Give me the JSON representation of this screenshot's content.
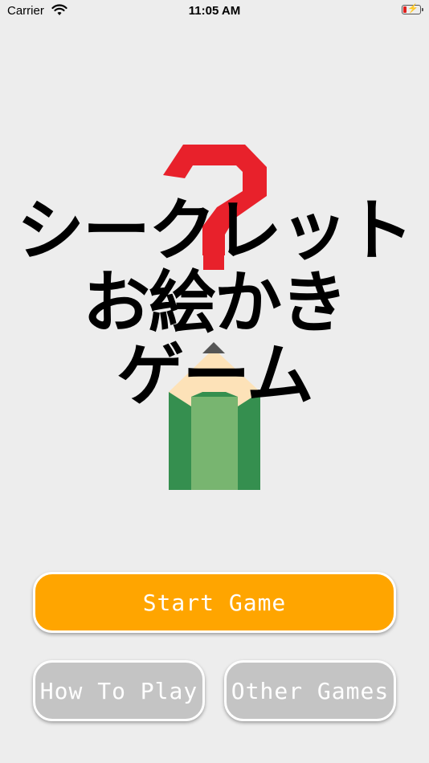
{
  "status_bar": {
    "carrier": "Carrier",
    "time": "11:05 AM",
    "battery_icon": "battery-low-charging-icon",
    "wifi_icon": "wifi-icon"
  },
  "logo": {
    "line1": "シークレット",
    "line2": "お絵かき",
    "line3": "ゲーム",
    "question_color": "#e8212b",
    "pencil_color": "#358f4f"
  },
  "buttons": {
    "start": "Start Game",
    "how_to_play": "How To Play",
    "other_games": "Other Games"
  },
  "colors": {
    "background": "#ededed",
    "start_button": "#ffa500",
    "secondary_button": "#c4c4c4"
  }
}
